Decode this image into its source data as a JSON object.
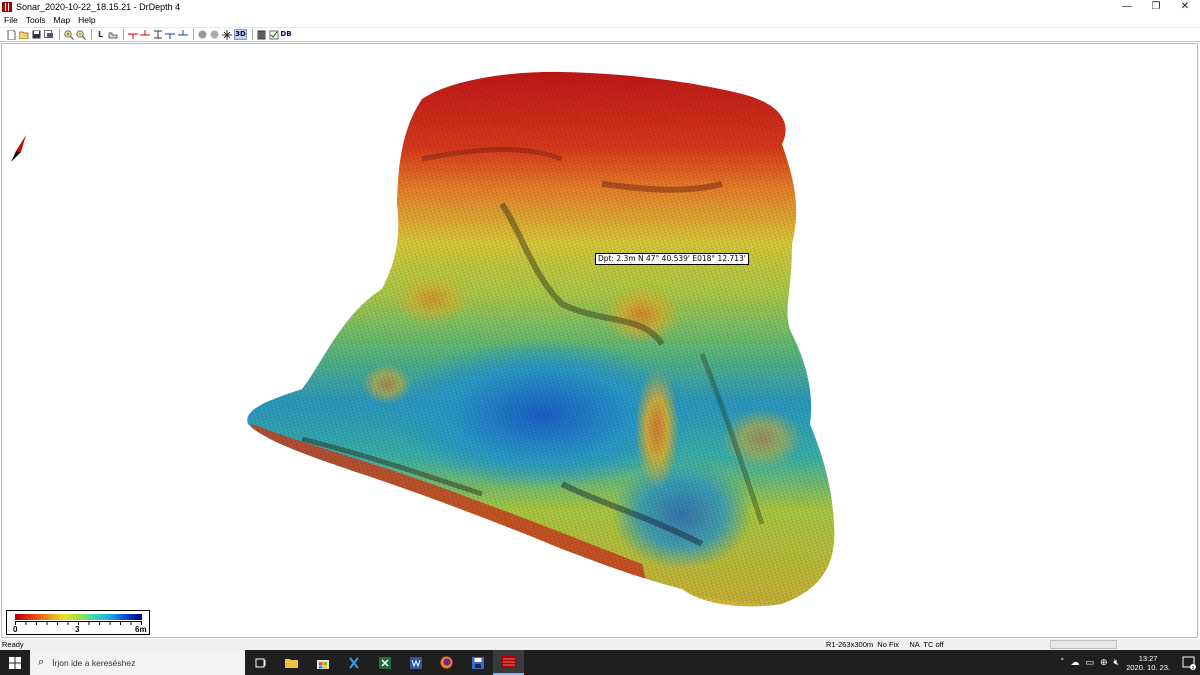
{
  "window": {
    "title": "Sonar_2020-10-22_18.15.21 - DrDepth 4",
    "minimize": "—",
    "maximize": "❐",
    "close": "✕"
  },
  "menu": [
    "File",
    "Tools",
    "Map",
    "Help"
  ],
  "toolbar": {
    "buttons": [
      "new-icon",
      "open-icon",
      "save-icon",
      "export-icon",
      "zoom-in-icon",
      "zoom-out-icon",
      "layer-l-icon",
      "area-icon",
      "pin-icon",
      "pin-icon",
      "range-icon",
      "pin-icon",
      "pin-icon",
      "shade-icon",
      "shade-icon",
      "move-icon",
      "3d-toggle",
      "grid-icon",
      "checklist-icon",
      "database-icon"
    ],
    "label_3d": "3D",
    "label_l": "L",
    "label_db": "DB"
  },
  "map": {
    "tooltip": "Dpt: 2.3m N 47° 40.539' E018° 12.713'",
    "legend": {
      "min_label": "0",
      "mid_label": "3",
      "max_label": "6m",
      "colors": [
        "#b80000",
        "#e83010",
        "#f08020",
        "#e8e020",
        "#a0e040",
        "#40d8b0",
        "#20a8e8",
        "#1040c8",
        "#000080"
      ]
    }
  },
  "status": {
    "left": "Ready",
    "right": "R1-263x300m  No Fix     NA  TC off"
  },
  "taskbar": {
    "search_placeholder": "Írjon ide a kereséshez",
    "apps": [
      "task-view-icon",
      "file-explorer-icon",
      "store-icon",
      "vscode-icon",
      "excel-icon",
      "word-icon",
      "firefox-icon",
      "drdepth-save-icon",
      "drdepth-icon"
    ],
    "clock_time": "13:27",
    "clock_date": "2020. 10. 23.",
    "notification_count": "2"
  }
}
